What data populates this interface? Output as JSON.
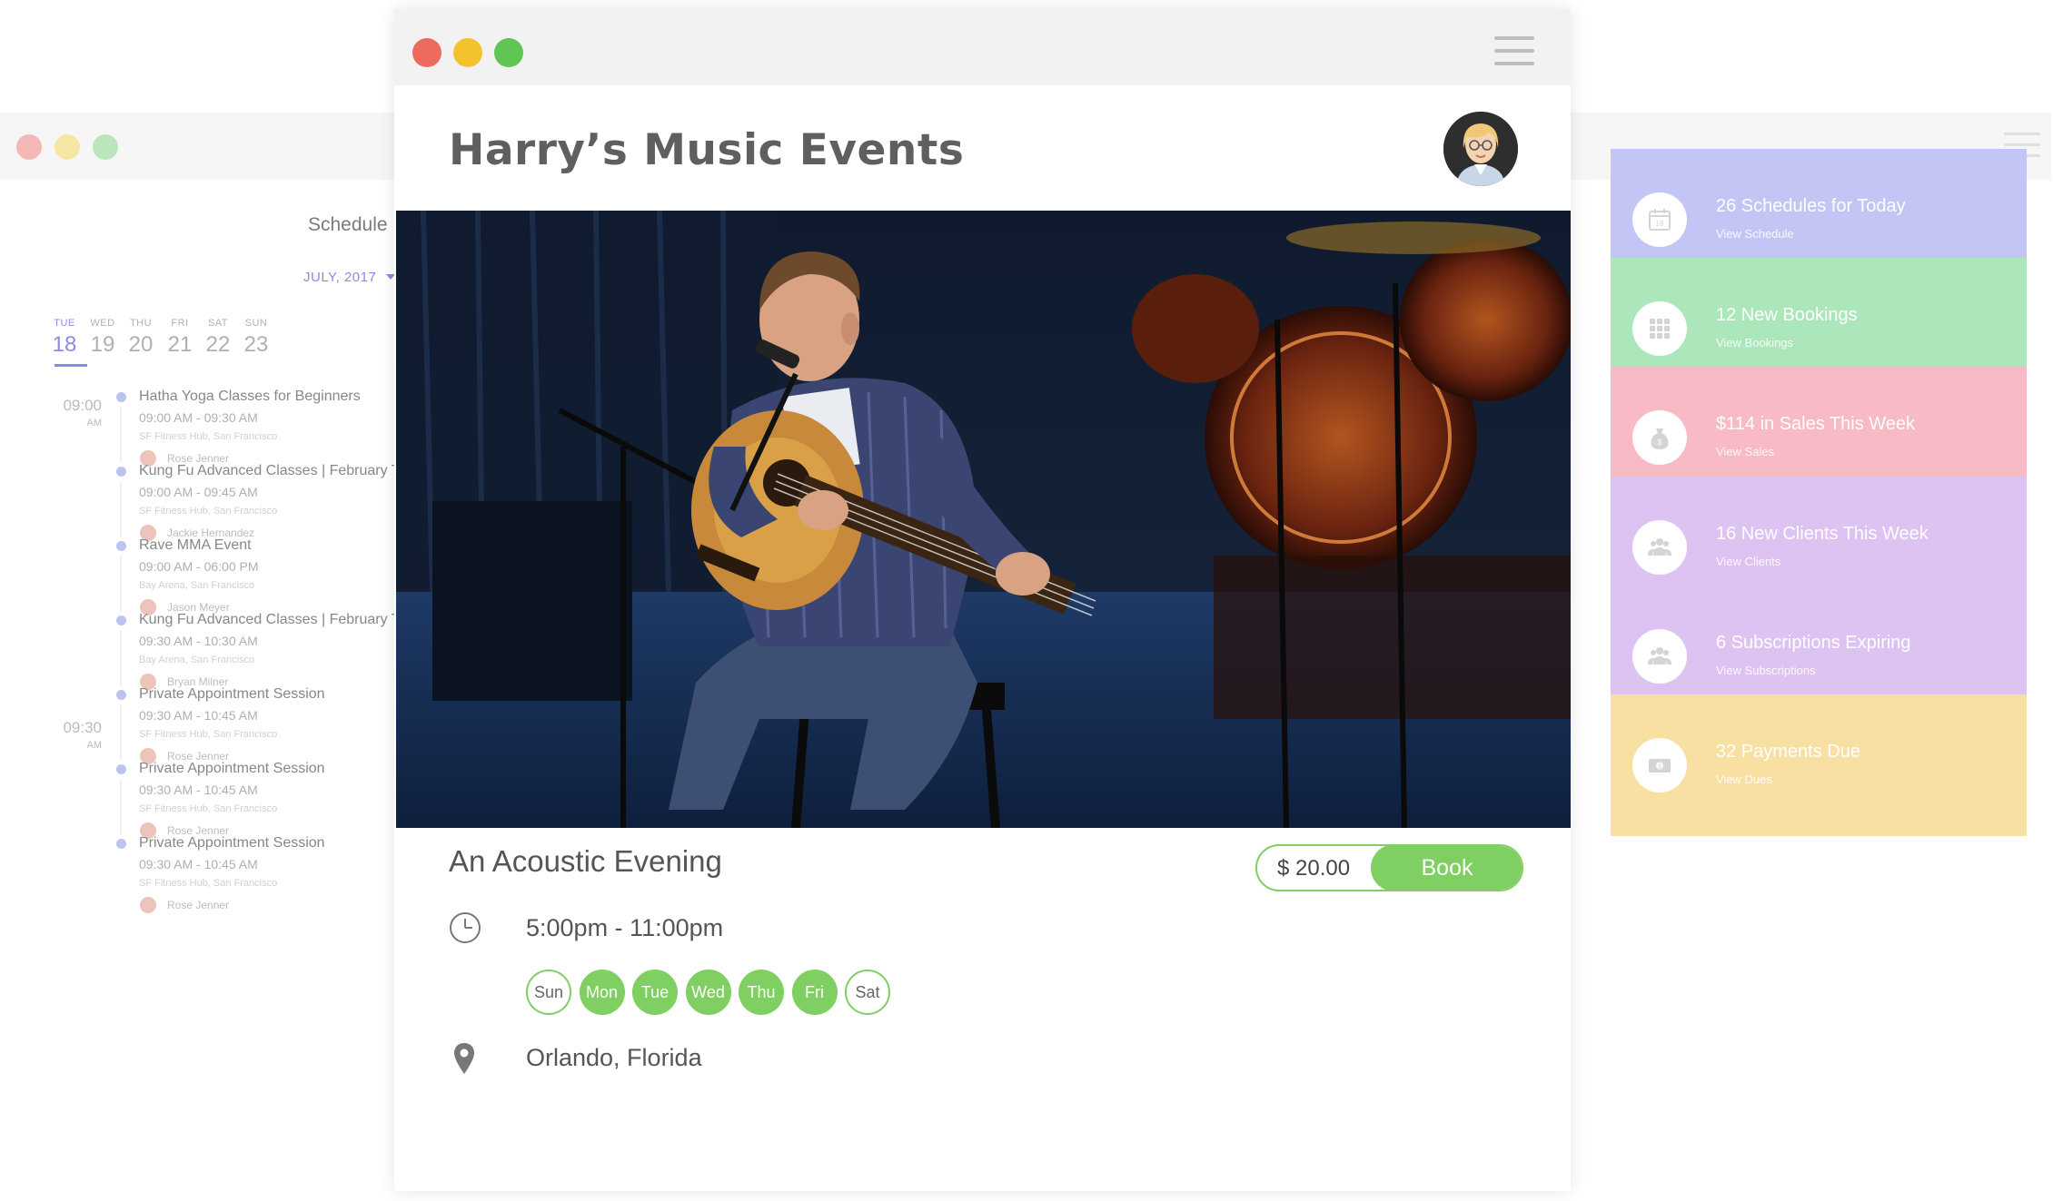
{
  "back_window": {
    "dots": [
      "#f4a3a3",
      "#f6e08a",
      "#a8dfa8"
    ],
    "schedule": {
      "title": "Schedule",
      "month": "JULY, 2017",
      "days": [
        {
          "name": "TUE",
          "num": "18",
          "active": true
        },
        {
          "name": "WED",
          "num": "19"
        },
        {
          "name": "THU",
          "num": "20"
        },
        {
          "name": "FRI",
          "num": "21"
        },
        {
          "name": "SAT",
          "num": "22"
        },
        {
          "name": "SUN",
          "num": "23"
        }
      ],
      "time_groups": [
        {
          "time": "09:00",
          "ampm": "AM"
        },
        {
          "time": "09:30",
          "ampm": "AM"
        }
      ],
      "events": [
        {
          "title": "Hatha Yoga Classes for Beginners",
          "time": "09:00 AM - 09:30 AM",
          "location": "SF Fitness Hub, San Francisco",
          "person": "Rose Jenner"
        },
        {
          "title": "Kung Fu Advanced Classes | February Te",
          "time": "09:00 AM - 09:45 AM",
          "location": "SF Fitness Hub, San Francisco",
          "person": "Jackie Hernandez"
        },
        {
          "title": "Rave MMA Event",
          "time": "09:00 AM - 06:00 PM",
          "location": "Bay Arena, San Francisco",
          "person": "Jason Meyer"
        },
        {
          "title": "Kung Fu Advanced Classes | February Te",
          "time": "09:30 AM - 10:30 AM",
          "location": "Bay Arena, San Francisco",
          "person": "Bryan Milner"
        },
        {
          "title": "Private Appointment Session",
          "time": "09:30 AM - 10:45 AM",
          "location": "SF Fitness Hub, San Francisco",
          "person": "Rose Jenner"
        },
        {
          "title": "Private Appointment Session",
          "time": "09:30 AM - 10:45 AM",
          "location": "SF Fitness Hub, San Francisco",
          "person": "Rose Jenner"
        },
        {
          "title": "Private Appointment Session",
          "time": "09:30 AM - 10:45 AM",
          "location": "SF Fitness Hub, San Francisco",
          "person": "Rose Jenner"
        }
      ]
    },
    "stats": [
      {
        "title": "26 Schedules for Today",
        "link": "View Schedule",
        "color": "#b3b5f1",
        "icon": "calendar-icon"
      },
      {
        "title": "12 New Bookings",
        "link": "View Bookings",
        "color": "#96dfa9",
        "icon": "grid-icon"
      },
      {
        "title": "$114 in Sales This Week",
        "link": "View Sales",
        "color": "#f7a9b7",
        "icon": "money-bag-icon"
      },
      {
        "title": "16 New Clients This Week",
        "link": "View Clients",
        "color": "#d4b3ef",
        "icon": "people-icon"
      },
      {
        "title": "6 Subscriptions Expiring",
        "link": "View Subscriptions",
        "color": "#d4b3ef",
        "icon": "people-icon"
      },
      {
        "title": "32 Payments Due",
        "link": "View Dues",
        "color": "#f7d889",
        "icon": "banknote-icon"
      }
    ]
  },
  "front_window": {
    "dots": [
      "#ec6a5e",
      "#f4c12f",
      "#61c554"
    ],
    "title": "Harry’s Music Events",
    "event": {
      "title": "An Acoustic Evening",
      "price": "$ 20.00",
      "book_label": "Book",
      "time": "5:00pm - 11:00pm",
      "days": [
        {
          "label": "Sun",
          "on": false
        },
        {
          "label": "Mon",
          "on": true
        },
        {
          "label": "Tue",
          "on": true
        },
        {
          "label": "Wed",
          "on": true
        },
        {
          "label": "Thu",
          "on": true
        },
        {
          "label": "Fri",
          "on": true
        },
        {
          "label": "Sat",
          "on": false
        }
      ],
      "location": "Orlando, Florida"
    },
    "accent": "#7fcf63"
  }
}
